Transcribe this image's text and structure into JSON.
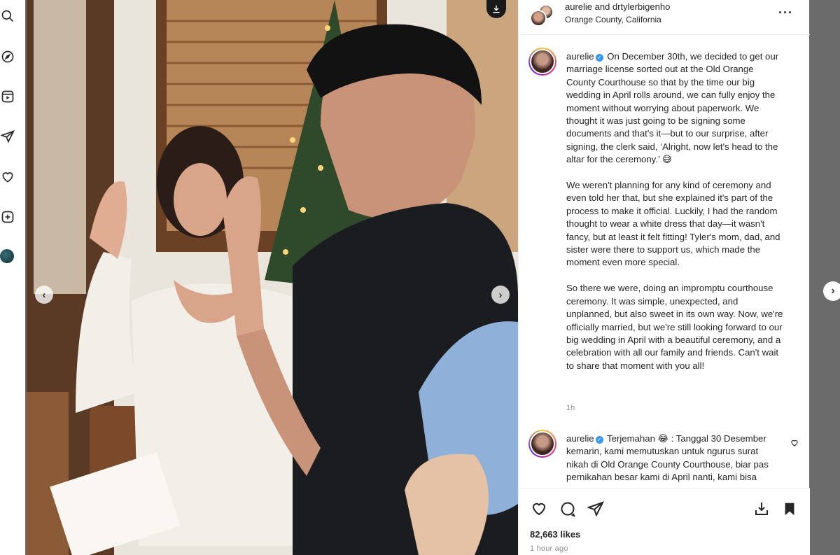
{
  "post": {
    "header": {
      "usernames": "aurelie and drtylerbigenho",
      "location": "Orange County, California"
    },
    "caption": {
      "username": "aurelie",
      "paragraphs": [
        "On December 30th, we decided to get our marriage license sorted out at the Old Orange County Courthouse so that by the time our big wedding in April rolls around, we can fully enjoy the moment without worrying about paperwork. We thought it was just going to be signing some documents and that's it—but to our surprise, after signing, the clerk said, ‘Alright, now let's head to the altar for the ceremony.’ 😅",
        "We weren't planning for any kind of ceremony and even told her that, but she explained it's part of the process to make it official. Luckily, I had the random thought to wear a white dress that day—it wasn't fancy, but at least it felt fitting! Tyler's mom, dad, and sister were there to support us, which made the moment even more special.",
        "So there we were, doing an impromptu courthouse ceremony. It was simple, unexpected, and unplanned, but also sweet in its own way. Now, we're officially married, but we're still looking forward to our big wedding in April with a beautiful ceremony, and a celebration with all our family and friends. Can't wait to share that moment with you all!"
      ],
      "time": "1h"
    },
    "comment": {
      "username": "aurelie",
      "label": "Terjemahan",
      "text": "Terjemahan 😂 : Tanggal 30 Desember kemarin, kami memutuskan untuk ngurus surat nikah di Old Orange County Courthouse, biar pas pernikahan besar kami di April nanti, kami bisa menikmati momennya"
    },
    "likes": "82,663 likes",
    "posted_ago": "1 hour ago"
  },
  "icons": {
    "rail": [
      "search-icon",
      "explore-icon",
      "reels-icon",
      "messages-icon",
      "notifications-icon",
      "create-icon"
    ],
    "actions": [
      "like-icon",
      "comment-icon",
      "share-icon",
      "save-to-collection-icon",
      "bookmark-icon"
    ]
  },
  "colors": {
    "verified": "#3897f0",
    "text": "#262626",
    "muted": "#8e8e8e"
  }
}
